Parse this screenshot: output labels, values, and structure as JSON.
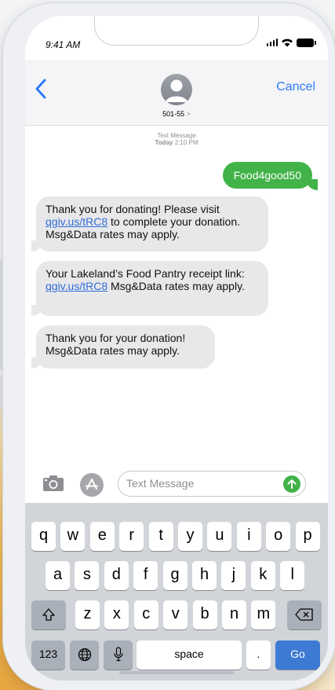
{
  "status_bar": {
    "time": "9:41 AM"
  },
  "header": {
    "back_icon": "chevron-left-icon",
    "cancel_label": "Cancel",
    "contact_number": "501-55",
    "contact_chevron": ">"
  },
  "thread": {
    "timestamp_label": "Text Message",
    "timestamp_day": "Today",
    "timestamp_time": "2:10 PM",
    "messages": [
      {
        "direction": "outgoing",
        "text": "Food4good50"
      },
      {
        "direction": "incoming",
        "text_before": "Thank you for donating! Please visit ",
        "link": "qgiv.us/tRC8",
        "text_after": " to complete your donation. Msg&Data rates may apply."
      },
      {
        "direction": "incoming",
        "text_before": "Your Lakeland’s Food Pantry receipt link: ",
        "link": "qgiv.us/tRC8",
        "text_after": " Msg&Data rates may apply."
      },
      {
        "direction": "incoming",
        "text": "Thank you for your donation! Msg&Data rates may apply."
      }
    ]
  },
  "composer": {
    "placeholder": "Text Message",
    "camera_icon": "camera-icon",
    "apps_icon": "app-store-icon",
    "send_icon": "send-arrow-icon"
  },
  "keyboard": {
    "row1": [
      "q",
      "w",
      "e",
      "r",
      "t",
      "y",
      "u",
      "i",
      "o",
      "p"
    ],
    "row2": [
      "a",
      "s",
      "d",
      "f",
      "g",
      "h",
      "j",
      "k",
      "l"
    ],
    "row3": [
      "z",
      "x",
      "c",
      "v",
      "b",
      "n",
      "m"
    ],
    "numbers_label": "123",
    "space_label": "space",
    "period_label": ".",
    "go_label": "Go",
    "shift_icon": "shift-icon",
    "delete_icon": "backspace-icon",
    "globe_icon": "globe-icon",
    "mic_icon": "microphone-icon"
  },
  "colors": {
    "outgoing_bubble": "#41b348",
    "incoming_bubble": "#e8e8ea",
    "accent": "#2f7bf6",
    "go_key": "#3d7ad4"
  }
}
